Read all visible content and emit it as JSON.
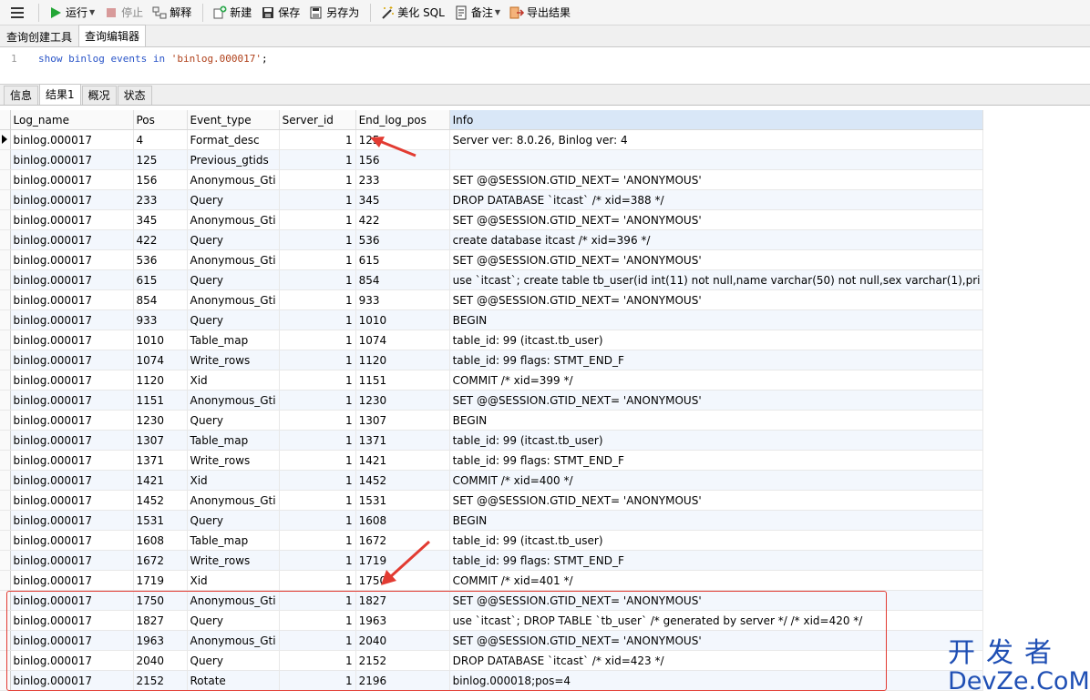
{
  "toolbar": {
    "run": "运行",
    "stop": "停止",
    "explain": "解释",
    "new": "新建",
    "save": "保存",
    "save_as": "另存为",
    "beautify": "美化 SQL",
    "comment": "备注",
    "export": "导出结果"
  },
  "query_tabs": [
    "查询创建工具",
    "查询编辑器"
  ],
  "editor": {
    "line_number": "1",
    "code": {
      "kw1": "show binlog events in ",
      "str": "'binlog.000017'",
      "end": ";"
    }
  },
  "result_tabs": [
    "信息",
    "结果1",
    "概况",
    "状态"
  ],
  "table": {
    "headers": [
      "Log_name",
      "Pos",
      "Event_type",
      "Server_id",
      "End_log_pos",
      "Info"
    ],
    "rows": [
      [
        "binlog.000017",
        "4",
        "Format_desc",
        "1",
        "125",
        "Server ver: 8.0.26, Binlog ver: 4"
      ],
      [
        "binlog.000017",
        "125",
        "Previous_gtids",
        "1",
        "156",
        ""
      ],
      [
        "binlog.000017",
        "156",
        "Anonymous_Gti",
        "1",
        "233",
        "SET @@SESSION.GTID_NEXT= 'ANONYMOUS'"
      ],
      [
        "binlog.000017",
        "233",
        "Query",
        "1",
        "345",
        "DROP DATABASE `itcast` /* xid=388 */"
      ],
      [
        "binlog.000017",
        "345",
        "Anonymous_Gti",
        "1",
        "422",
        "SET @@SESSION.GTID_NEXT= 'ANONYMOUS'"
      ],
      [
        "binlog.000017",
        "422",
        "Query",
        "1",
        "536",
        "create database itcast /* xid=396 */"
      ],
      [
        "binlog.000017",
        "536",
        "Anonymous_Gti",
        "1",
        "615",
        "SET @@SESSION.GTID_NEXT= 'ANONYMOUS'"
      ],
      [
        "binlog.000017",
        "615",
        "Query",
        "1",
        "854",
        "use `itcast`; create table tb_user(id int(11) not null,name varchar(50) not null,sex varchar(1),pri"
      ],
      [
        "binlog.000017",
        "854",
        "Anonymous_Gti",
        "1",
        "933",
        "SET @@SESSION.GTID_NEXT= 'ANONYMOUS'"
      ],
      [
        "binlog.000017",
        "933",
        "Query",
        "1",
        "1010",
        "BEGIN"
      ],
      [
        "binlog.000017",
        "1010",
        "Table_map",
        "1",
        "1074",
        "table_id: 99 (itcast.tb_user)"
      ],
      [
        "binlog.000017",
        "1074",
        "Write_rows",
        "1",
        "1120",
        "table_id: 99 flags: STMT_END_F"
      ],
      [
        "binlog.000017",
        "1120",
        "Xid",
        "1",
        "1151",
        "COMMIT /* xid=399 */"
      ],
      [
        "binlog.000017",
        "1151",
        "Anonymous_Gti",
        "1",
        "1230",
        "SET @@SESSION.GTID_NEXT= 'ANONYMOUS'"
      ],
      [
        "binlog.000017",
        "1230",
        "Query",
        "1",
        "1307",
        "BEGIN"
      ],
      [
        "binlog.000017",
        "1307",
        "Table_map",
        "1",
        "1371",
        "table_id: 99 (itcast.tb_user)"
      ],
      [
        "binlog.000017",
        "1371",
        "Write_rows",
        "1",
        "1421",
        "table_id: 99 flags: STMT_END_F"
      ],
      [
        "binlog.000017",
        "1421",
        "Xid",
        "1",
        "1452",
        "COMMIT /* xid=400 */"
      ],
      [
        "binlog.000017",
        "1452",
        "Anonymous_Gti",
        "1",
        "1531",
        "SET @@SESSION.GTID_NEXT= 'ANONYMOUS'"
      ],
      [
        "binlog.000017",
        "1531",
        "Query",
        "1",
        "1608",
        "BEGIN"
      ],
      [
        "binlog.000017",
        "1608",
        "Table_map",
        "1",
        "1672",
        "table_id: 99 (itcast.tb_user)"
      ],
      [
        "binlog.000017",
        "1672",
        "Write_rows",
        "1",
        "1719",
        "table_id: 99 flags: STMT_END_F"
      ],
      [
        "binlog.000017",
        "1719",
        "Xid",
        "1",
        "1750",
        "COMMIT /* xid=401 */"
      ],
      [
        "binlog.000017",
        "1750",
        "Anonymous_Gti",
        "1",
        "1827",
        "SET @@SESSION.GTID_NEXT= 'ANONYMOUS'"
      ],
      [
        "binlog.000017",
        "1827",
        "Query",
        "1",
        "1963",
        "use `itcast`; DROP TABLE `tb_user` /* generated by server */ /* xid=420 */"
      ],
      [
        "binlog.000017",
        "1963",
        "Anonymous_Gti",
        "1",
        "2040",
        "SET @@SESSION.GTID_NEXT= 'ANONYMOUS'"
      ],
      [
        "binlog.000017",
        "2040",
        "Query",
        "1",
        "2152",
        "DROP DATABASE `itcast` /* xid=423 */"
      ],
      [
        "binlog.000017",
        "2152",
        "Rotate",
        "1",
        "2196",
        "binlog.000018;pos=4"
      ]
    ]
  },
  "watermark": {
    "line1": "开发者",
    "line2": "DevZe.CoM"
  },
  "colors": {
    "annotation_red": "#e23b32",
    "watermark_blue": "#1f4fb4",
    "info_header": "#d9e7f7"
  }
}
